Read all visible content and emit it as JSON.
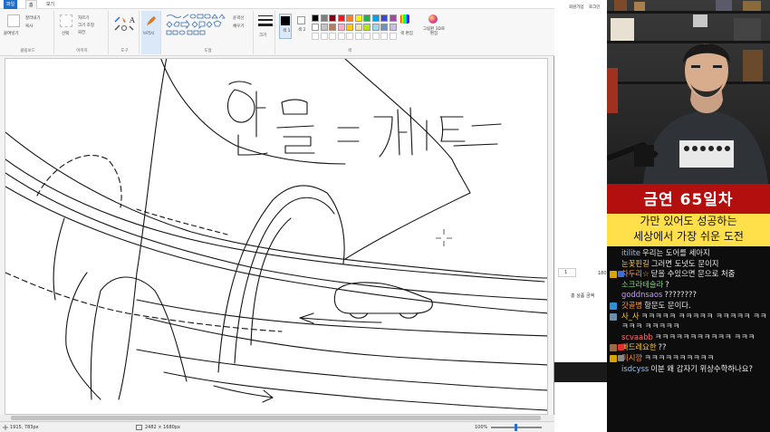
{
  "paint": {
    "tabs": [
      "파일",
      "홈",
      "보기"
    ],
    "groups": {
      "clipboard": {
        "label": "클립보드",
        "paste": "붙여넣기",
        "cut": "잘라내기",
        "copy": "복사"
      },
      "image": {
        "label": "이미지",
        "select": "선택",
        "crop": "자르기",
        "resize": "크기 조정",
        "rotate": "회전"
      },
      "tools": {
        "label": "도구"
      },
      "brushes": {
        "label": "브러시"
      },
      "shapes": {
        "label": "도형",
        "outline": "윤곽선",
        "fill": "채우기"
      },
      "size": {
        "label": "크기"
      },
      "colors": {
        "label": "색",
        "color1": "색 1",
        "color2": "색 2",
        "edit_colors": "색 편집",
        "paint3d": "그림판 3D로 편집"
      }
    },
    "palette": [
      "#000000",
      "#7f7f7f",
      "#880015",
      "#ed1c24",
      "#ff7f27",
      "#fff200",
      "#22b14c",
      "#00a2e8",
      "#3f48cc",
      "#a349a4",
      "#ffffff",
      "#c3c3c3",
      "#b97a57",
      "#ffaec9",
      "#ffc90e",
      "#efe4b0",
      "#b5e61d",
      "#99d9ea",
      "#7092be",
      "#c8bfe7"
    ],
    "status": {
      "cursor": "1915, 783px",
      "dimensions": "2482 × 1680px",
      "zoom": "100%"
    }
  },
  "browser": {
    "top_links": [
      "회원가입",
      "로그인"
    ],
    "qty": "1",
    "price": "180",
    "total_label": "총 상품 금액"
  },
  "stream": {
    "banner": "금연 65일차",
    "subtitle_line1": "가만 있어도 성공하는",
    "subtitle_line2": "세상에서 가장 쉬운 도전",
    "chat": [
      {
        "nick": "itilite",
        "text": "우리는 도어를 세아지",
        "nick_color": "#8ec5ff",
        "badge": ""
      },
      {
        "nick": "눈꽃핀길",
        "text": "그러면 도넛도 문이지",
        "nick_color": "#f6c744",
        "badge": ""
      },
      {
        "nick": "차두리☆",
        "text": "닫을 수있으면 문으로 처줌",
        "nick_color": "#ff9a3c",
        "badge": "#d9a400",
        "badge2": "#3b6fd8"
      },
      {
        "nick": "소크라테슬라",
        "text": "?",
        "nick_color": "#7fd67f",
        "badge": ""
      },
      {
        "nick": "goddnsaos",
        "text": "????????",
        "nick_color": "#c59cff",
        "badge": ""
      },
      {
        "nick": "갓골병",
        "text": "항문도 문이다.",
        "nick_color": "#ff9a3c",
        "badge": "#2f8fd8"
      },
      {
        "nick": "사_사",
        "text": "ㅋㅋㅋㅋㅋ ㅋㅋㅋㅋㅋ ㅋㅋㅋㅋㅋ ㅋㅋㅋㅋㅋ ㅋㅋㅋㅋㅋ",
        "nick_color": "#f6c744",
        "badge": "#6a8fb0"
      },
      {
        "nick": "scvaabb",
        "text": "ㅋㅋㅋㅋㅋㅋㅋㅋㅋㅋㅋ ㅋㅋㅋ",
        "nick_color": "#ff6a6a",
        "badge": ""
      },
      {
        "nick": "빠드레요한",
        "text": "??",
        "nick_color": "#f6c744",
        "badge": "#9c6b3f",
        "badge2": "#e03030"
      },
      {
        "nick": "미시깡",
        "text": "ㅋㅋㅋㅋㅋㅋㅋㅋㅋㅋ",
        "nick_color": "#ff9a3c",
        "badge": "#d9a400",
        "badge2": "#888888"
      },
      {
        "nick": "isdcyss",
        "text": "이분 왜 갑자기 위상수학하나요?",
        "nick_color": "#8ec5ff",
        "badge": ""
      }
    ]
  },
  "drawing": {
    "handwritten_text": "항문=게이트"
  }
}
